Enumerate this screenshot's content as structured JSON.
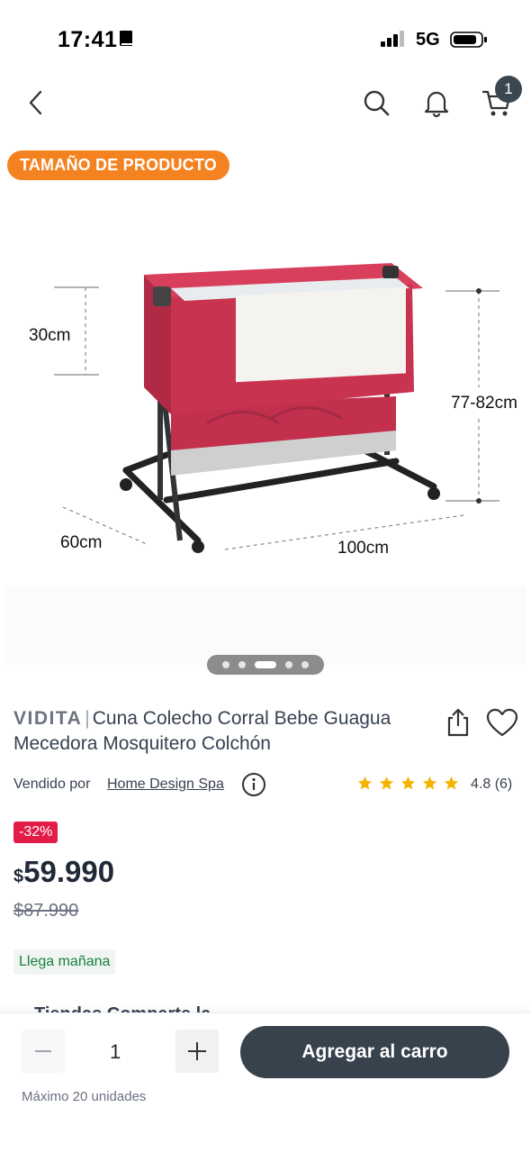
{
  "status_bar": {
    "time": "17:41",
    "network": "5G"
  },
  "nav": {
    "cart_count": "1"
  },
  "gallery": {
    "tag": "TAMAÑO DE PRODUCTO",
    "dimensions": {
      "height_side": "30cm",
      "height_total": "77-82cm",
      "depth": "60cm",
      "width": "100cm"
    },
    "slides_total": 5,
    "active_slide": 3
  },
  "product": {
    "brand": "VIDITA",
    "separator": "|",
    "title": "Cuna Colecho Corral Bebe Guagua Mecedora Mosquitero Colchón",
    "sold_by_label": "Vendido por",
    "seller": "Home Design Spa",
    "rating": "4.8",
    "reviews": "(6)",
    "stars": 5,
    "discount": "-32%",
    "currency": "$",
    "price": "59.990",
    "old_price": "$87.990",
    "delivery": "Llega mañana",
    "section_peek": "Tiendas      Comparte la"
  },
  "bottom": {
    "quantity": "1",
    "add_to_cart": "Agregar al carro",
    "max_units": "Máximo 20 unidades"
  },
  "colors": {
    "accent_orange": "#f58220",
    "discount_red": "#e11d48",
    "button_dark": "#37424d",
    "delivery_green": "#15803d",
    "star_yellow": "#f5b301",
    "crib_pink": "#c8334f"
  }
}
